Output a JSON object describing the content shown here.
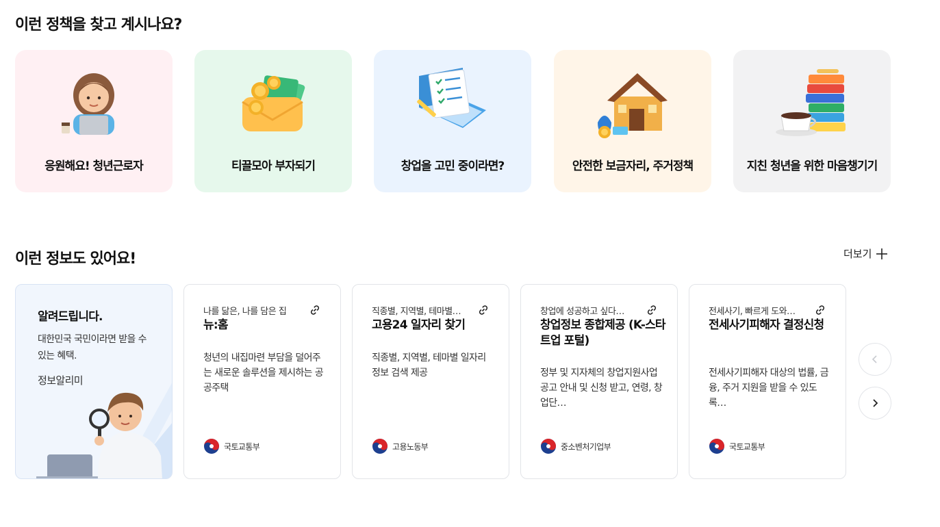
{
  "policy_section": {
    "title": "이런 정책을 찾고 계시나요?",
    "topics": [
      {
        "label": "응원해요! 청년근로자",
        "bg": "#fff0f3"
      },
      {
        "label": "티끌모아 부자되기",
        "bg": "#e6f8ec"
      },
      {
        "label": "창업을 고민 중이라면?",
        "bg": "#eaf3fe"
      },
      {
        "label": "안전한 보금자리, 주거정책",
        "bg": "#fff5e8"
      },
      {
        "label": "지친 청년을 위한 마음챙기기",
        "bg": "#f2f2f3"
      }
    ]
  },
  "info_section": {
    "title": "이런 정보도 있어요!",
    "more_label": "더보기",
    "notice": {
      "title": "알려드립니다.",
      "desc": "대한민국 국민이라면 받을 수 있는 혜택.",
      "brand": "정보알리미"
    },
    "cards": [
      {
        "sub": "나를 닮은, 나를 담은 집",
        "title": "뉴:홈",
        "desc": "청년의 내집마련 부담을 덜어주는 새로운 솔루션을 제시하는 공공주택",
        "org": "국토교통부"
      },
      {
        "sub": "직종별, 지역별, 테마별…",
        "title": "고용24 일자리 찾기",
        "desc": "직종별, 지역별, 테마별 일자리 정보 검색 제공",
        "org": "고용노동부"
      },
      {
        "sub": "창업에 성공하고 싶다…",
        "title": "창업정보 종합제공 (K-스타트업 포털)",
        "desc": "정부 및 지자체의 창업지원사업 공고 안내 및 신청 받고, 연령, 창업단…",
        "org": "중소벤처기업부"
      },
      {
        "sub": "전세사기, 빠르게 도와…",
        "title": "전세사기피해자 결정신청",
        "desc": "전세사기피해자 대상의 법률, 금융, 주거 지원을 받을 수 있도록…",
        "org": "국토교통부"
      }
    ]
  },
  "icons": {
    "link": "link-icon",
    "prev": "chevron-left-icon",
    "next": "chevron-right-icon",
    "plus": "plus-icon",
    "emblem": "taegeuk-emblem-icon"
  }
}
